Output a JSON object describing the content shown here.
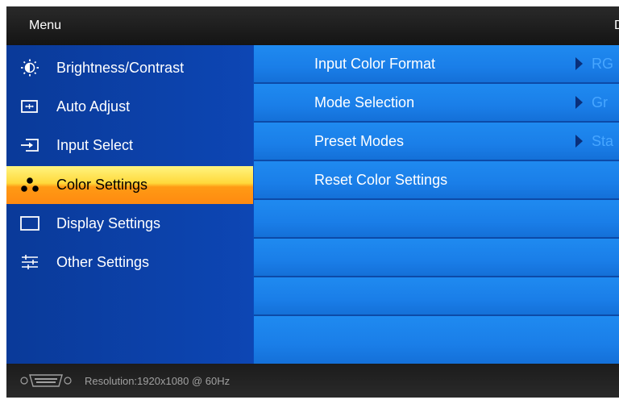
{
  "header": {
    "title": "Menu",
    "right_clipped": "D"
  },
  "sidebar": {
    "items": [
      {
        "label": "Brightness/Contrast",
        "icon": "brightness-icon"
      },
      {
        "label": "Auto Adjust",
        "icon": "auto-adjust-icon"
      },
      {
        "label": "Input Select",
        "icon": "input-select-icon"
      },
      {
        "label": "Color Settings",
        "icon": "color-settings-icon",
        "selected": true
      },
      {
        "label": "Display Settings",
        "icon": "display-settings-icon"
      },
      {
        "label": "Other Settings",
        "icon": "other-settings-icon"
      }
    ]
  },
  "content": {
    "rows": [
      {
        "label": "Input Color Format",
        "value": "RG"
      },
      {
        "label": "Mode Selection",
        "value": "Gr"
      },
      {
        "label": "Preset Modes",
        "value": "Sta"
      },
      {
        "label": "Reset Color Settings",
        "value": ""
      },
      {
        "label": "",
        "value": ""
      },
      {
        "label": "",
        "value": ""
      },
      {
        "label": "",
        "value": ""
      },
      {
        "label": "",
        "value": ""
      }
    ]
  },
  "footer": {
    "resolution": "Resolution:1920x1080 @ 60Hz",
    "icon": "vga-connector-icon"
  },
  "colors": {
    "selected_top": "#fff480",
    "selected_bottom": "#ff8a10",
    "sidebar": "#0d46b4",
    "row": "#1a7ee8"
  }
}
